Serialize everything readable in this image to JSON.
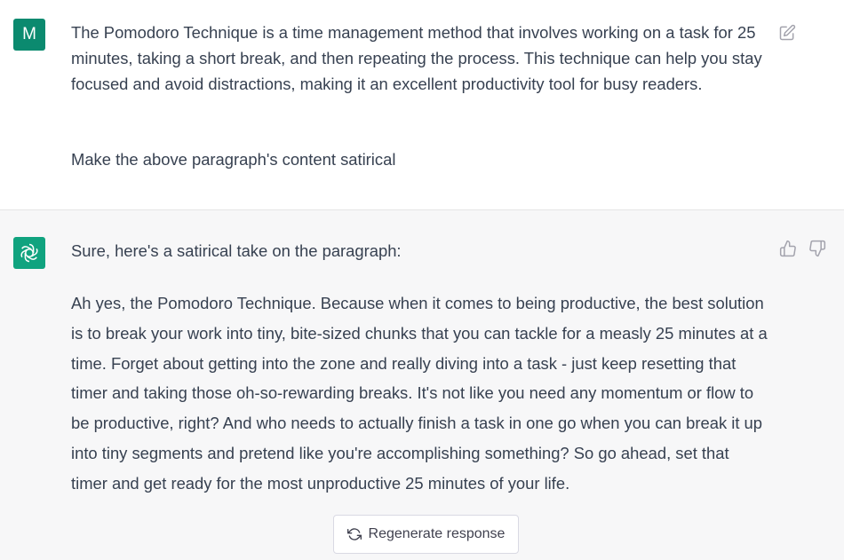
{
  "user": {
    "avatar_letter": "M",
    "avatar_color": "#0b8a6f",
    "message": "The Pomodoro Technique is a time management method that involves working on a task for 25 minutes, taking a short break, and then repeating the process. This technique can help you stay focused and avoid distractions, making it an excellent productivity tool for busy readers.",
    "instruction": "Make the above paragraph's content satirical",
    "edit_icon": "edit-icon"
  },
  "assistant": {
    "avatar_icon": "openai-logo-icon",
    "avatar_color": "#10a37f",
    "intro": "Sure, here's a satirical take on the paragraph:",
    "body": "Ah yes, the Pomodoro Technique. Because when it comes to being productive, the best solution is to break your work into tiny, bite-sized chunks that you can tackle for a measly 25 minutes at a time. Forget about getting into the zone and really diving into a task - just keep resetting that timer and taking those oh-so-rewarding breaks. It's not like you need any momentum or flow to be productive, right? And who needs to actually finish a task in one go when you can break it up into tiny segments and pretend like you're accomplishing something? So go ahead, set that timer and get ready for the most unproductive 25 minutes of your life.",
    "feedback_icons": [
      "thumbs-up-icon",
      "thumbs-down-icon"
    ]
  },
  "regenerate": {
    "label": "Regenerate response",
    "icon": "refresh-icon"
  }
}
